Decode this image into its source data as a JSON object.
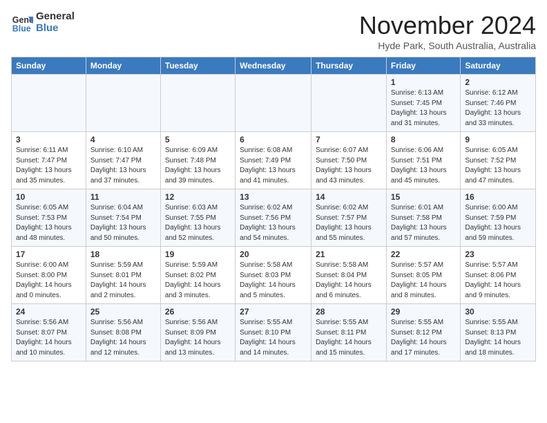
{
  "logo": {
    "line1": "General",
    "line2": "Blue"
  },
  "title": "November 2024",
  "location": "Hyde Park, South Australia, Australia",
  "days_of_week": [
    "Sunday",
    "Monday",
    "Tuesday",
    "Wednesday",
    "Thursday",
    "Friday",
    "Saturday"
  ],
  "weeks": [
    [
      {
        "day": "",
        "info": ""
      },
      {
        "day": "",
        "info": ""
      },
      {
        "day": "",
        "info": ""
      },
      {
        "day": "",
        "info": ""
      },
      {
        "day": "",
        "info": ""
      },
      {
        "day": "1",
        "info": "Sunrise: 6:13 AM\nSunset: 7:45 PM\nDaylight: 13 hours\nand 31 minutes."
      },
      {
        "day": "2",
        "info": "Sunrise: 6:12 AM\nSunset: 7:46 PM\nDaylight: 13 hours\nand 33 minutes."
      }
    ],
    [
      {
        "day": "3",
        "info": "Sunrise: 6:11 AM\nSunset: 7:47 PM\nDaylight: 13 hours\nand 35 minutes."
      },
      {
        "day": "4",
        "info": "Sunrise: 6:10 AM\nSunset: 7:47 PM\nDaylight: 13 hours\nand 37 minutes."
      },
      {
        "day": "5",
        "info": "Sunrise: 6:09 AM\nSunset: 7:48 PM\nDaylight: 13 hours\nand 39 minutes."
      },
      {
        "day": "6",
        "info": "Sunrise: 6:08 AM\nSunset: 7:49 PM\nDaylight: 13 hours\nand 41 minutes."
      },
      {
        "day": "7",
        "info": "Sunrise: 6:07 AM\nSunset: 7:50 PM\nDaylight: 13 hours\nand 43 minutes."
      },
      {
        "day": "8",
        "info": "Sunrise: 6:06 AM\nSunset: 7:51 PM\nDaylight: 13 hours\nand 45 minutes."
      },
      {
        "day": "9",
        "info": "Sunrise: 6:05 AM\nSunset: 7:52 PM\nDaylight: 13 hours\nand 47 minutes."
      }
    ],
    [
      {
        "day": "10",
        "info": "Sunrise: 6:05 AM\nSunset: 7:53 PM\nDaylight: 13 hours\nand 48 minutes."
      },
      {
        "day": "11",
        "info": "Sunrise: 6:04 AM\nSunset: 7:54 PM\nDaylight: 13 hours\nand 50 minutes."
      },
      {
        "day": "12",
        "info": "Sunrise: 6:03 AM\nSunset: 7:55 PM\nDaylight: 13 hours\nand 52 minutes."
      },
      {
        "day": "13",
        "info": "Sunrise: 6:02 AM\nSunset: 7:56 PM\nDaylight: 13 hours\nand 54 minutes."
      },
      {
        "day": "14",
        "info": "Sunrise: 6:02 AM\nSunset: 7:57 PM\nDaylight: 13 hours\nand 55 minutes."
      },
      {
        "day": "15",
        "info": "Sunrise: 6:01 AM\nSunset: 7:58 PM\nDaylight: 13 hours\nand 57 minutes."
      },
      {
        "day": "16",
        "info": "Sunrise: 6:00 AM\nSunset: 7:59 PM\nDaylight: 13 hours\nand 59 minutes."
      }
    ],
    [
      {
        "day": "17",
        "info": "Sunrise: 6:00 AM\nSunset: 8:00 PM\nDaylight: 14 hours\nand 0 minutes."
      },
      {
        "day": "18",
        "info": "Sunrise: 5:59 AM\nSunset: 8:01 PM\nDaylight: 14 hours\nand 2 minutes."
      },
      {
        "day": "19",
        "info": "Sunrise: 5:59 AM\nSunset: 8:02 PM\nDaylight: 14 hours\nand 3 minutes."
      },
      {
        "day": "20",
        "info": "Sunrise: 5:58 AM\nSunset: 8:03 PM\nDaylight: 14 hours\nand 5 minutes."
      },
      {
        "day": "21",
        "info": "Sunrise: 5:58 AM\nSunset: 8:04 PM\nDaylight: 14 hours\nand 6 minutes."
      },
      {
        "day": "22",
        "info": "Sunrise: 5:57 AM\nSunset: 8:05 PM\nDaylight: 14 hours\nand 8 minutes."
      },
      {
        "day": "23",
        "info": "Sunrise: 5:57 AM\nSunset: 8:06 PM\nDaylight: 14 hours\nand 9 minutes."
      }
    ],
    [
      {
        "day": "24",
        "info": "Sunrise: 5:56 AM\nSunset: 8:07 PM\nDaylight: 14 hours\nand 10 minutes."
      },
      {
        "day": "25",
        "info": "Sunrise: 5:56 AM\nSunset: 8:08 PM\nDaylight: 14 hours\nand 12 minutes."
      },
      {
        "day": "26",
        "info": "Sunrise: 5:56 AM\nSunset: 8:09 PM\nDaylight: 14 hours\nand 13 minutes."
      },
      {
        "day": "27",
        "info": "Sunrise: 5:55 AM\nSunset: 8:10 PM\nDaylight: 14 hours\nand 14 minutes."
      },
      {
        "day": "28",
        "info": "Sunrise: 5:55 AM\nSunset: 8:11 PM\nDaylight: 14 hours\nand 15 minutes."
      },
      {
        "day": "29",
        "info": "Sunrise: 5:55 AM\nSunset: 8:12 PM\nDaylight: 14 hours\nand 17 minutes."
      },
      {
        "day": "30",
        "info": "Sunrise: 5:55 AM\nSunset: 8:13 PM\nDaylight: 14 hours\nand 18 minutes."
      }
    ]
  ]
}
